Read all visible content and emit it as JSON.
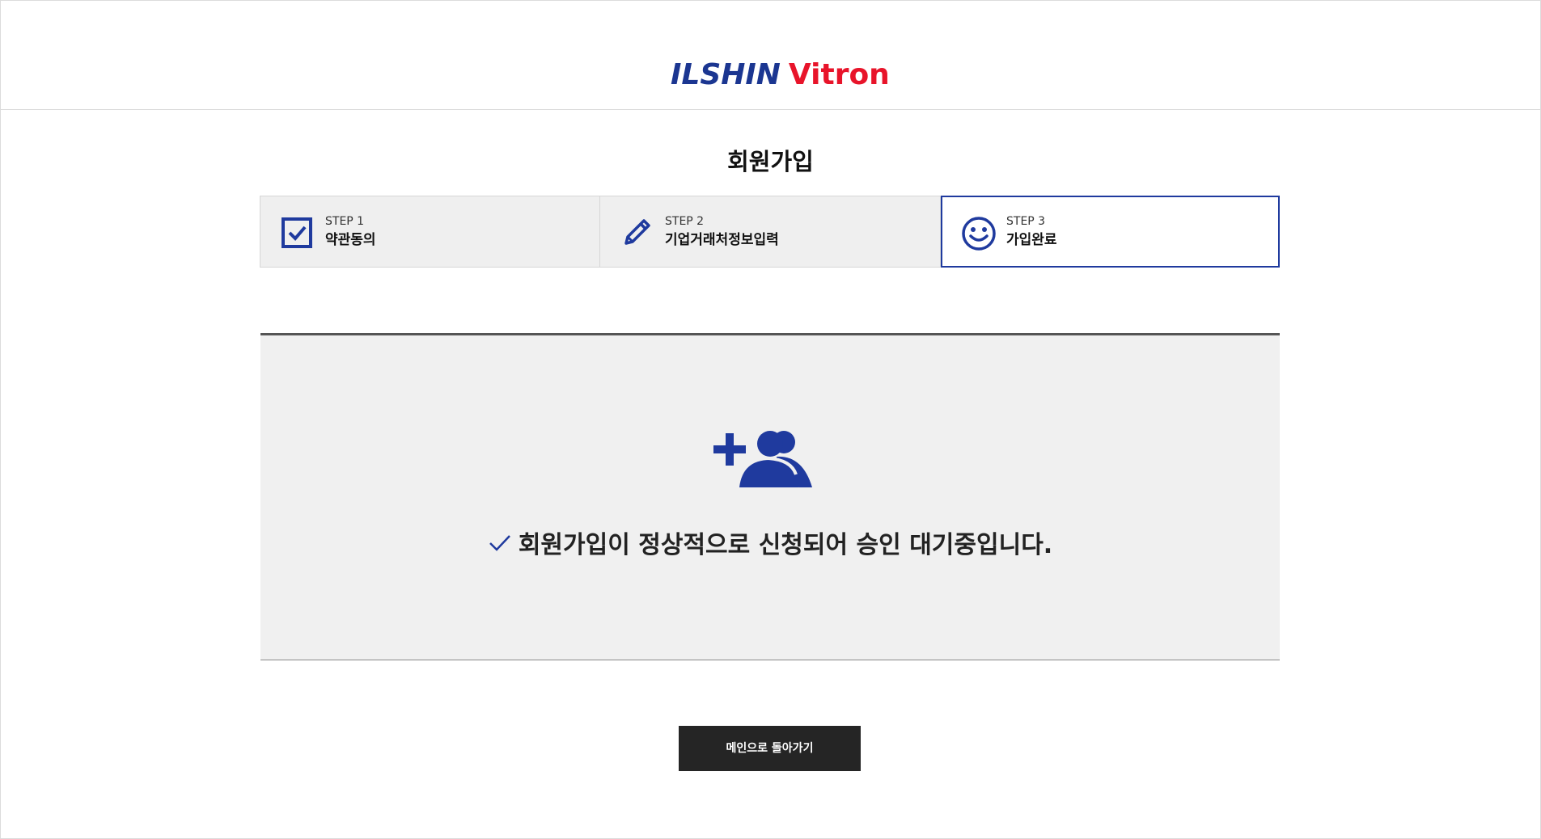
{
  "brand": {
    "logo_part1": "ILSHIN",
    "logo_part2": "Vitron",
    "colors": {
      "navy": "#1b3691",
      "red": "#e8142a"
    }
  },
  "page": {
    "title": "회원가입"
  },
  "steps": [
    {
      "number": "STEP 1",
      "label": "약관동의",
      "icon": "checkbox-icon",
      "active": false
    },
    {
      "number": "STEP 2",
      "label": "기업거래처정보입력",
      "icon": "pencil-icon",
      "active": false
    },
    {
      "number": "STEP 3",
      "label": "가입완료",
      "icon": "smiley-icon",
      "active": true
    }
  ],
  "result": {
    "icon": "add-users-icon",
    "message": "회원가입이 정상적으로 신청되어 승인 대기중입니다."
  },
  "actions": {
    "back_label": "메인으로 돌아가기"
  },
  "colors": {
    "accent": "#1f3a9e",
    "panel_bg": "#f0f0f0",
    "button_bg": "#252525"
  }
}
